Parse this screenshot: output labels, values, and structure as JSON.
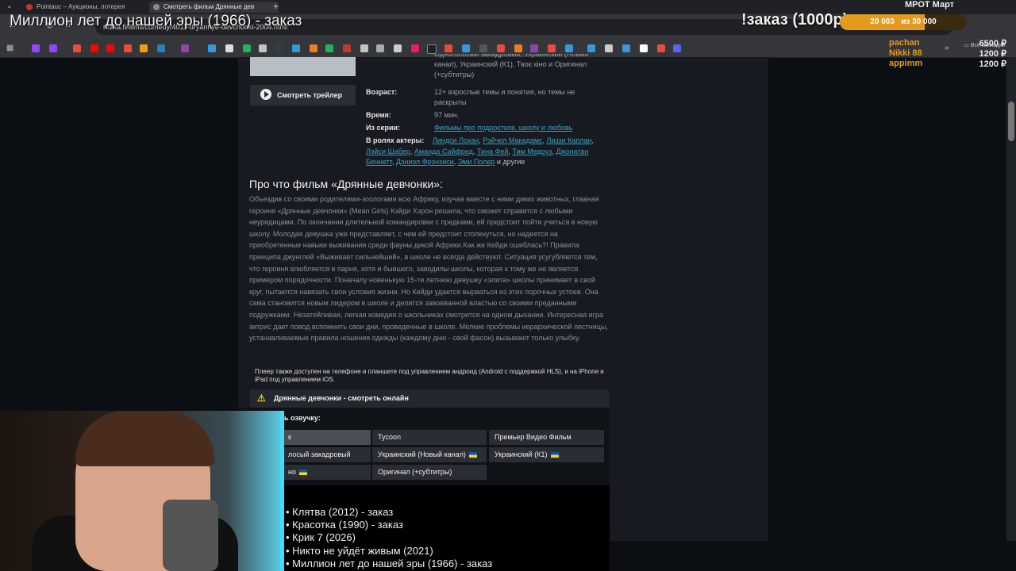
{
  "tabs": [
    {
      "label": "Pointauc – Аукционы, лотерея"
    },
    {
      "label": "Смотреть фильм Дрянные дев"
    }
  ],
  "address_bar": {
    "url": "rezka.fi/films/comedy/4011-dryannye-devchonki-2004.html"
  },
  "bookmarks": {
    "more_label": "Все закладки"
  },
  "stream_overlay": {
    "title": "Миллион лет до нашей эры (1966) - заказ",
    "order_label": "!заказ (1000р)",
    "mrot_label": "МРОТ Март",
    "progress": {
      "current": "20 003",
      "total": "из 30 000",
      "fraction": 0.667
    },
    "donors": [
      {
        "name": "pachan",
        "amount": "6500 ₽"
      },
      {
        "name": "Nikki 88",
        "amount": "1200 ₽"
      },
      {
        "name": "appimm",
        "amount": "1200 ₽"
      }
    ]
  },
  "film": {
    "trailer_label": "Смотреть трейлер",
    "voices_top": "Одноголосый закадровый, Украинский (Новый канал), Украинский (К1), Твоє кіно и Оригинал (+субтитры)",
    "age_label": "Возраст:",
    "age_value": "12+ взрослые темы и понятия, но темы не раскрыты",
    "time_label": "Время:",
    "time_value": "97 мин.",
    "series_label": "Из серии:",
    "series_value": "Фильмы про подростков, школу и любовь",
    "actors_label": "В ролях актеры:",
    "actors": [
      "Линдси Лохан",
      "Рэйчел Макадамс",
      "Лиззи Каплан",
      "Лэйси Шабер",
      "Аманда Сайфред",
      "Тина Фей",
      "Тим Медоуз",
      "Джонатан Беннетт",
      "Дэниэл Фрэнзиси",
      "Эми Полер"
    ],
    "actors_suffix": "и другие",
    "about_title": "Про что фильм «Дрянные девчонки»:",
    "about_text": "Объездив со своими родителями-зоологами всю Африку, изучая вместе с ними диких животных, главная героиня «Дрянные девчонки» (Mean Girls) Кэйди Хэрон решила, что сможет справится с любыми неурядицами. По окончании длительной командировки с предками, ей предстоит пойти учиться в новую школу. Молодая девушка уже представляет, с чем ей предстоит столкнуться, но надеется на приобретенные навыки выживания среди фауны дикой Африки.Как же Кейди ошиблась?! Правила принципа джунглей «Выживает сильнейший», в школе не всегда действуют. Ситуация усугубляется тем, что героиня влюбляется в парня, хотя и бывшего, заводилы школы, которая к тому же не является примером порядочности. Поначалу новенькую 15-ти летнюю девушку «элита» школы принимает в свой круг, пытаются навязать свои условия жизни. Но Кейди удается вырваться из этих порочных устоев. Она сама становится новым лидером в школе и делится завоеванной властью со своими преданными подружками. Незатейливая, легкая комедия о школьниках смотрится на одном дыхании. Интересная игра актрис дает повод вспомнить свои дни, проведенные в школе. Мелкие проблемы иерархической лестницы, устанавливаемые правила ношения одежды (каждому дню - свой фасон) вызывают только улыбку.",
    "player_note": "Плеер также доступен на телефоне и планшете под управлением андроид (Android с поддержкой HLS), и на iPhone и iPad под управлением iOS.",
    "watch_online": "Дрянные девчонки - смотреть онлайн",
    "voice_label": "ь озвучку:",
    "voice_buttons": [
      {
        "label": "к",
        "active": true
      },
      {
        "label": "Tycoon"
      },
      {
        "label": "Премьер Видео Фильм"
      },
      {
        "label": "лосый закадровый"
      },
      {
        "label": "Украинский (Новый канал)",
        "flag": true
      },
      {
        "label": "Украинский (К1)",
        "flag": true
      },
      {
        "label": "но",
        "flag": true
      },
      {
        "label": "Оригинал (+субтитры)"
      }
    ]
  },
  "order_queue": [
    "• Клятва (2012) - заказ",
    "• Красотка (1990) - заказ",
    "• Крик 7 (2026)",
    "• Никто не уйдёт живым (2021)",
    "• Миллион лет до нашей эры (1966) - заказ"
  ],
  "colors": {
    "accent_orange": "#e39a1e",
    "link": "#3aa0c0",
    "cam_border": "#3fdcff"
  }
}
